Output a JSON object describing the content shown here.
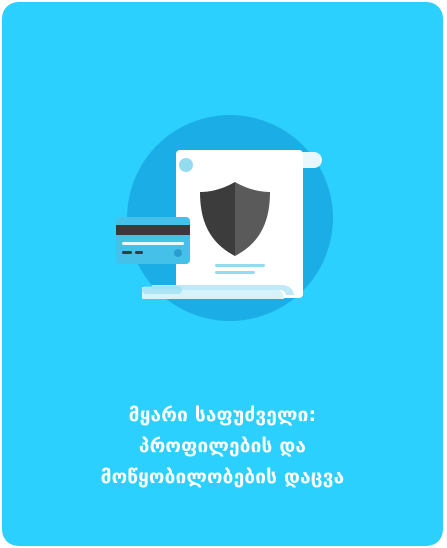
{
  "colors": {
    "card_background": "#2cd0ff",
    "circle": "#1baee6",
    "document": "#ffffff",
    "document_lines": "#93dcef",
    "shield_dark": "#3c3c3c",
    "shield_light": "#5a5a5a",
    "credit_card": "#45c1e9",
    "credit_card_stripe": "#3a3a3a",
    "caption_text": "#ffffff"
  },
  "illustration": {
    "icons": [
      "document-icon",
      "shield-icon",
      "credit-card-icon"
    ]
  },
  "caption": {
    "line1": "მყარი საფუძველი:",
    "line2": "პროფილების და",
    "line3": "მოწყობილობების დაცვა"
  }
}
